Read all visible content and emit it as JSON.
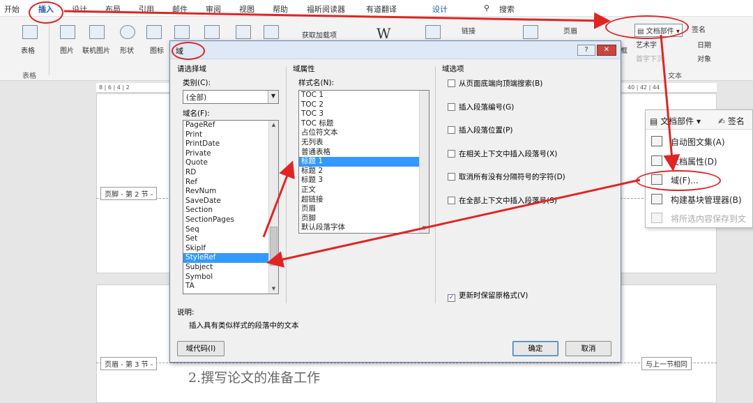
{
  "ribbon_tabs": [
    "开始",
    "插入",
    "设计",
    "布局",
    "引用",
    "邮件",
    "审阅",
    "视图",
    "帮助",
    "福昕阅读器",
    "有道翻译",
    "设计"
  ],
  "ribbon_search": "搜索",
  "ribbon": {
    "table_label": "表格",
    "table_group": "表格",
    "picture_label": "图片",
    "online_picture_label": "联机图片",
    "shapes_label": "形状",
    "icons_label": "图标",
    "get_addins_label": "获取加载项",
    "link_label": "链接",
    "header_label": "页眉",
    "docparts_label": "文档部件",
    "wordart_label": "艺术字",
    "dropcap_label": "首字下沉",
    "textbox_label": "框",
    "signature_label": "签名",
    "date_label": "日期",
    "object_label": "对象",
    "text_group": "文本"
  },
  "ruler_left": "8 | 6 | 4 | 2",
  "ruler_right": "40 | 42 | 44",
  "document": {
    "footer_label": "页脚 - 第 2 节 -",
    "header_label": "页眉 - 第 3 节 -",
    "same_as_previous": "与上一节相同",
    "heading": "2.撰写论文的准备工作"
  },
  "dialog": {
    "title": "域",
    "help_btn": "?",
    "close_btn": "✕",
    "choose_field_label": "请选择域",
    "category_label": "类别(C):",
    "category_value": "(全部)",
    "field_names_label": "域名(F):",
    "field_names": [
      "PageRef",
      "Print",
      "PrintDate",
      "Private",
      "Quote",
      "RD",
      "Ref",
      "RevNum",
      "SaveDate",
      "Section",
      "SectionPages",
      "Seq",
      "Set",
      "SkipIf",
      "StyleRef",
      "Subject",
      "Symbol",
      "TA"
    ],
    "field_selected": "StyleRef",
    "field_props_label": "域属性",
    "style_name_label": "样式名(N):",
    "style_names": [
      "TOC 1",
      "TOC 2",
      "TOC 3",
      "TOC 标题",
      "占位符文本",
      "无列表",
      "普通表格",
      "标题 1",
      "标题 2",
      "标题 3",
      "正文",
      "超链接",
      "页眉",
      "页脚",
      "默认段落字体"
    ],
    "style_selected": "标题 1",
    "field_options_label": "域选项",
    "options": [
      {
        "label": "从页面底端向顶端搜索(B)",
        "checked": false
      },
      {
        "label": "插入段落编号(G)",
        "checked": false
      },
      {
        "label": "插入段落位置(P)",
        "checked": false
      },
      {
        "label": "在相关上下文中插入段落号(X)",
        "checked": false
      },
      {
        "label": "取消所有没有分隔符号的字符(D)",
        "checked": false
      },
      {
        "label": "在全部上下文中插入段落号(S)",
        "checked": false
      }
    ],
    "preserve_format": {
      "label": "更新时保留原格式(V)",
      "checked": true
    },
    "description_label": "说明:",
    "description_text": "插入具有类似样式的段落中的文本",
    "field_codes_btn": "域代码(I)",
    "ok_btn": "确定",
    "cancel_btn": "取消"
  },
  "popup": {
    "header_button": "文档部件",
    "signature_button": "签名",
    "items": [
      {
        "label": "自动图文集(A)",
        "disabled": false
      },
      {
        "label": "文档属性(D)",
        "disabled": false
      },
      {
        "label": "域(F)...",
        "disabled": false
      },
      {
        "label": "构建基块管理器(B)",
        "disabled": false
      },
      {
        "label": "将所选内容保存到文",
        "disabled": true
      }
    ]
  },
  "colors": {
    "annotation": "#e02424",
    "accent": "#1e5aa8",
    "selection": "#3399ff"
  }
}
